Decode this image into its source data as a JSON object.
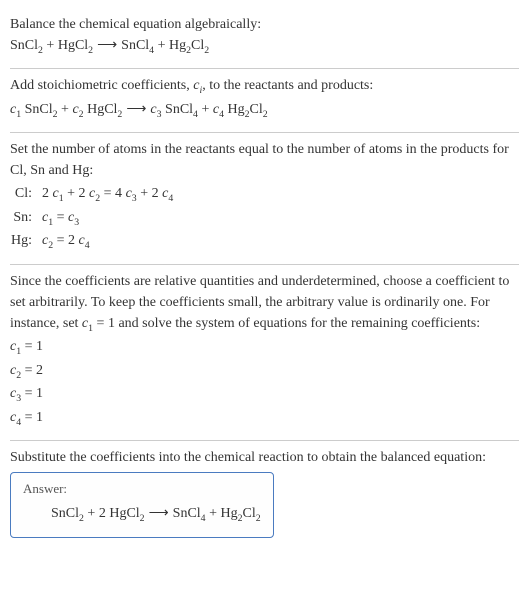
{
  "s1": {
    "title": "Balance the chemical equation algebraically:",
    "eq_r1": "SnCl",
    "eq_r1_sub": "2",
    "eq_plus1": " + ",
    "eq_r2": "HgCl",
    "eq_r2_sub": "2",
    "arrow": "⟶",
    "eq_p1": "SnCl",
    "eq_p1_sub": "4",
    "eq_plus2": " + ",
    "eq_p2": "Hg",
    "eq_p2_sub1": "2",
    "eq_p2b": "Cl",
    "eq_p2_sub2": "2"
  },
  "s2": {
    "title_a": "Add stoichiometric coefficients, ",
    "title_c": "c",
    "title_i": "i",
    "title_b": ", to the reactants and products:",
    "c1": "c",
    "c1s": "1",
    "sp": " ",
    "r1": "SnCl",
    "r1s": "2",
    "plus1": " + ",
    "c2": "c",
    "c2s": "2",
    "r2": "HgCl",
    "r2s": "2",
    "arrow": "⟶",
    "c3": "c",
    "c3s": "3",
    "p1": "SnCl",
    "p1s": "4",
    "plus2": " + ",
    "c4": "c",
    "c4s": "4",
    "p2a": "Hg",
    "p2as": "2",
    "p2b": "Cl",
    "p2bs": "2"
  },
  "s3": {
    "title": "Set the number of atoms in the reactants equal to the number of atoms in the products for Cl, Sn and Hg:",
    "rows": [
      {
        "label": "Cl:",
        "eq_a": "2 ",
        "c1": "c",
        "c1s": "1",
        "mid1": " + 2 ",
        "c2": "c",
        "c2s": "2",
        "mid2": " = 4 ",
        "c3": "c",
        "c3s": "3",
        "mid3": " + 2 ",
        "c4": "c",
        "c4s": "4"
      },
      {
        "label": "Sn:",
        "eq_a": "",
        "c1": "c",
        "c1s": "1",
        "mid1": " = ",
        "c2": "c",
        "c2s": "3",
        "mid2": "",
        "c3": "",
        "c3s": "",
        "mid3": "",
        "c4": "",
        "c4s": ""
      },
      {
        "label": "Hg:",
        "eq_a": "",
        "c1": "c",
        "c1s": "2",
        "mid1": " = 2 ",
        "c2": "c",
        "c2s": "4",
        "mid2": "",
        "c3": "",
        "c3s": "",
        "mid3": "",
        "c4": "",
        "c4s": ""
      }
    ]
  },
  "s4": {
    "text_a": "Since the coefficients are relative quantities and underdetermined, choose a coefficient to set arbitrarily. To keep the coefficients small, the arbitrary value is ordinarily one. For instance, set ",
    "cv": "c",
    "cvs": "1",
    "text_b": " = 1 and solve the system of equations for the remaining coefficients:",
    "rows": [
      {
        "c": "c",
        "cs": "1",
        "eq": " = 1"
      },
      {
        "c": "c",
        "cs": "2",
        "eq": " = 2"
      },
      {
        "c": "c",
        "cs": "3",
        "eq": " = 1"
      },
      {
        "c": "c",
        "cs": "4",
        "eq": " = 1"
      }
    ]
  },
  "s5": {
    "title": "Substitute the coefficients into the chemical reaction to obtain the balanced equation:",
    "answer_label": "Answer:",
    "r1": "SnCl",
    "r1s": "2",
    "plus1": " + 2 ",
    "r2": "HgCl",
    "r2s": "2",
    "arrow": "⟶",
    "p1": "SnCl",
    "p1s": "4",
    "plus2": " + ",
    "p2a": "Hg",
    "p2as": "2",
    "p2b": "Cl",
    "p2bs": "2"
  }
}
